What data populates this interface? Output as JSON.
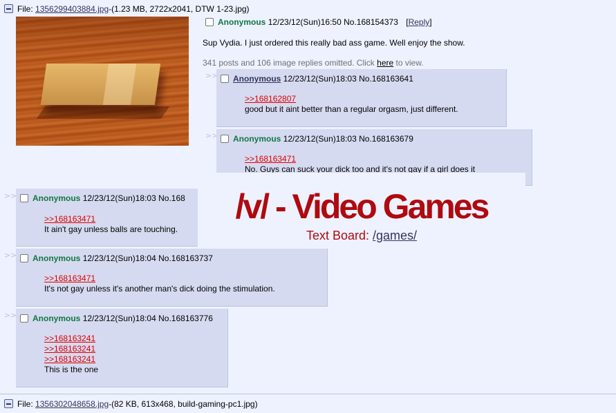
{
  "op": {
    "file_label": "File:",
    "file_name": "1356299403884.jpg",
    "file_info": "-(1.23 MB, 2722x2041, DTW 1-23.jpg)",
    "name": "Anonymous",
    "datetime": "12/23/12(Sun)16:50",
    "number": "No.168154373",
    "reply_link": "Reply",
    "reply_open": "[",
    "reply_close": "]",
    "body": "Sup Vydia. I just ordered this really bad ass game. Well enjoy the show.",
    "omitted_pre": "341 posts and 106 image replies omitted. Click ",
    "omitted_link": "here",
    "omitted_post": " to view."
  },
  "arrows": ">>",
  "replies": [
    {
      "name": "Anonymous",
      "datetime": "12/23/12(Sun)18:03",
      "number": "No.168163641",
      "quotes": [
        ">>168162807"
      ],
      "body": "good but it aint better than a regular orgasm, just different."
    },
    {
      "name": "Anonymous",
      "datetime": "12/23/12(Sun)18:03",
      "number": "No.168163679",
      "quotes": [
        ">>168163471"
      ],
      "body": "No. Guys can suck your dick too and it's not gay if a girl does it"
    },
    {
      "name": "Anonymous",
      "datetime": "12/23/12(Sun)18:03",
      "number": "No.168",
      "quotes": [
        ">>168163471"
      ],
      "body": "It ain't gay unless balls are touching."
    },
    {
      "name": "Anonymous",
      "datetime": "12/23/12(Sun)18:04",
      "number": "No.168163737",
      "quotes": [
        ">>168163471"
      ],
      "body": "It's not gay unless it's another man's dick doing the stimulation."
    },
    {
      "name": "Anonymous",
      "datetime": "12/23/12(Sun)18:04",
      "number": "No.168163776",
      "quotes": [
        ">>168163241",
        ">>168163241",
        ">>168163241"
      ],
      "body": "This is the one"
    }
  ],
  "banner": {
    "title": "/v/ - Video Games",
    "sub_label": "Text Board: ",
    "sub_link": "/games/",
    "color": "#af0a0f"
  },
  "next_thread": {
    "file_label": "File:",
    "file_name": "1356302048658.jpg",
    "file_info": "-(82 KB, 613x468, build-gaming-pc1.jpg)"
  },
  "colors": {
    "background": "#eef2ff",
    "reply_bg": "#d6daf0",
    "name": "#117743",
    "quote": "#dd0000",
    "link": "#34345c"
  },
  "icons": [
    "minus-icon",
    "checkbox"
  ]
}
